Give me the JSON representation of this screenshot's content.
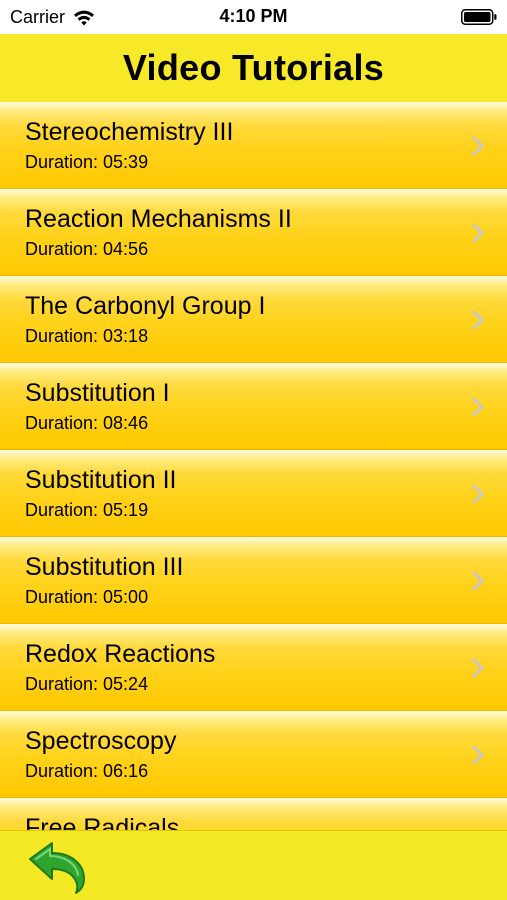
{
  "status_bar": {
    "carrier": "Carrier",
    "time": "4:10 PM",
    "wifi_icon": "wifi-icon",
    "battery_icon": "battery-icon"
  },
  "header": {
    "title": "Video Tutorials"
  },
  "tutorials": [
    {
      "title": "Stereochemistry III",
      "duration": "Duration: 05:39"
    },
    {
      "title": "Reaction Mechanisms II",
      "duration": "Duration: 04:56"
    },
    {
      "title": "The Carbonyl Group I",
      "duration": "Duration: 03:18"
    },
    {
      "title": "Substitution I",
      "duration": "Duration: 08:46"
    },
    {
      "title": "Substitution II",
      "duration": "Duration: 05:19"
    },
    {
      "title": "Substitution III",
      "duration": "Duration: 05:00"
    },
    {
      "title": "Redox Reactions",
      "duration": "Duration: 05:24"
    },
    {
      "title": "Spectroscopy",
      "duration": "Duration: 06:16"
    },
    {
      "title": "Free Radicals",
      "duration": ""
    }
  ],
  "toolbar": {
    "back_icon": "back-arrow-icon"
  },
  "colors": {
    "header_bg": "#f7e927",
    "row_gradient_top": "#fffbe0",
    "row_gradient_bottom": "#ffc800",
    "back_arrow": "#2fa52f",
    "chevron": "#c7c7cc"
  }
}
